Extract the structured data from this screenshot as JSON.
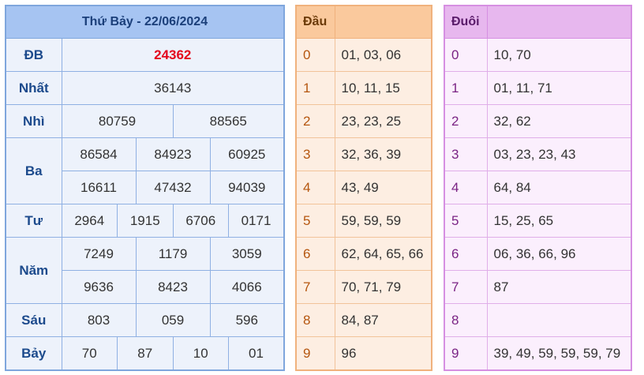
{
  "results": {
    "title": "Thứ Bảy - 22/06/2024",
    "db": {
      "label": "ĐB",
      "values": [
        "24362"
      ]
    },
    "nhat": {
      "label": "Nhất",
      "values": [
        "36143"
      ]
    },
    "nhi": {
      "label": "Nhì",
      "values": [
        "80759",
        "88565"
      ]
    },
    "ba": {
      "label": "Ba",
      "values": [
        "86584",
        "84923",
        "60925",
        "16611",
        "47432",
        "94039"
      ]
    },
    "tu": {
      "label": "Tư",
      "values": [
        "2964",
        "1915",
        "6706",
        "0171"
      ]
    },
    "nam": {
      "label": "Năm",
      "values": [
        "7249",
        "1179",
        "3059",
        "9636",
        "8423",
        "4066"
      ]
    },
    "sau": {
      "label": "Sáu",
      "values": [
        "803",
        "059",
        "596"
      ]
    },
    "bay": {
      "label": "Bảy",
      "values": [
        "70",
        "87",
        "10",
        "01"
      ]
    }
  },
  "dau": {
    "header": "Đầu",
    "rows": [
      {
        "digit": "0",
        "values": "01, 03, 06"
      },
      {
        "digit": "1",
        "values": "10, 11, 15"
      },
      {
        "digit": "2",
        "values": "23, 23, 25"
      },
      {
        "digit": "3",
        "values": "32, 36, 39"
      },
      {
        "digit": "4",
        "values": "43, 49"
      },
      {
        "digit": "5",
        "values": "59, 59, 59"
      },
      {
        "digit": "6",
        "values": "62, 64, 65, 66"
      },
      {
        "digit": "7",
        "values": "70, 71, 79"
      },
      {
        "digit": "8",
        "values": "84, 87"
      },
      {
        "digit": "9",
        "values": "96"
      }
    ]
  },
  "duoi": {
    "header": "Đuôi",
    "rows": [
      {
        "digit": "0",
        "values": "10, 70"
      },
      {
        "digit": "1",
        "values": "01, 11, 71"
      },
      {
        "digit": "2",
        "values": "32, 62"
      },
      {
        "digit": "3",
        "values": "03, 23, 23, 43"
      },
      {
        "digit": "4",
        "values": "64, 84"
      },
      {
        "digit": "5",
        "values": "15, 25, 65"
      },
      {
        "digit": "6",
        "values": "06, 36, 66, 96"
      },
      {
        "digit": "7",
        "values": "87"
      },
      {
        "digit": "8",
        "values": ""
      },
      {
        "digit": "9",
        "values": "39, 49, 59, 59, 59, 79"
      }
    ]
  },
  "colors": {
    "results_header": "#a6c4f2",
    "results_cell": "#edf2fb",
    "special_prize": "#e4061d",
    "dau_header": "#fac99d",
    "dau_cell": "#fdeee2",
    "duoi_header": "#e7b7ee",
    "duoi_cell": "#fbeffd"
  }
}
